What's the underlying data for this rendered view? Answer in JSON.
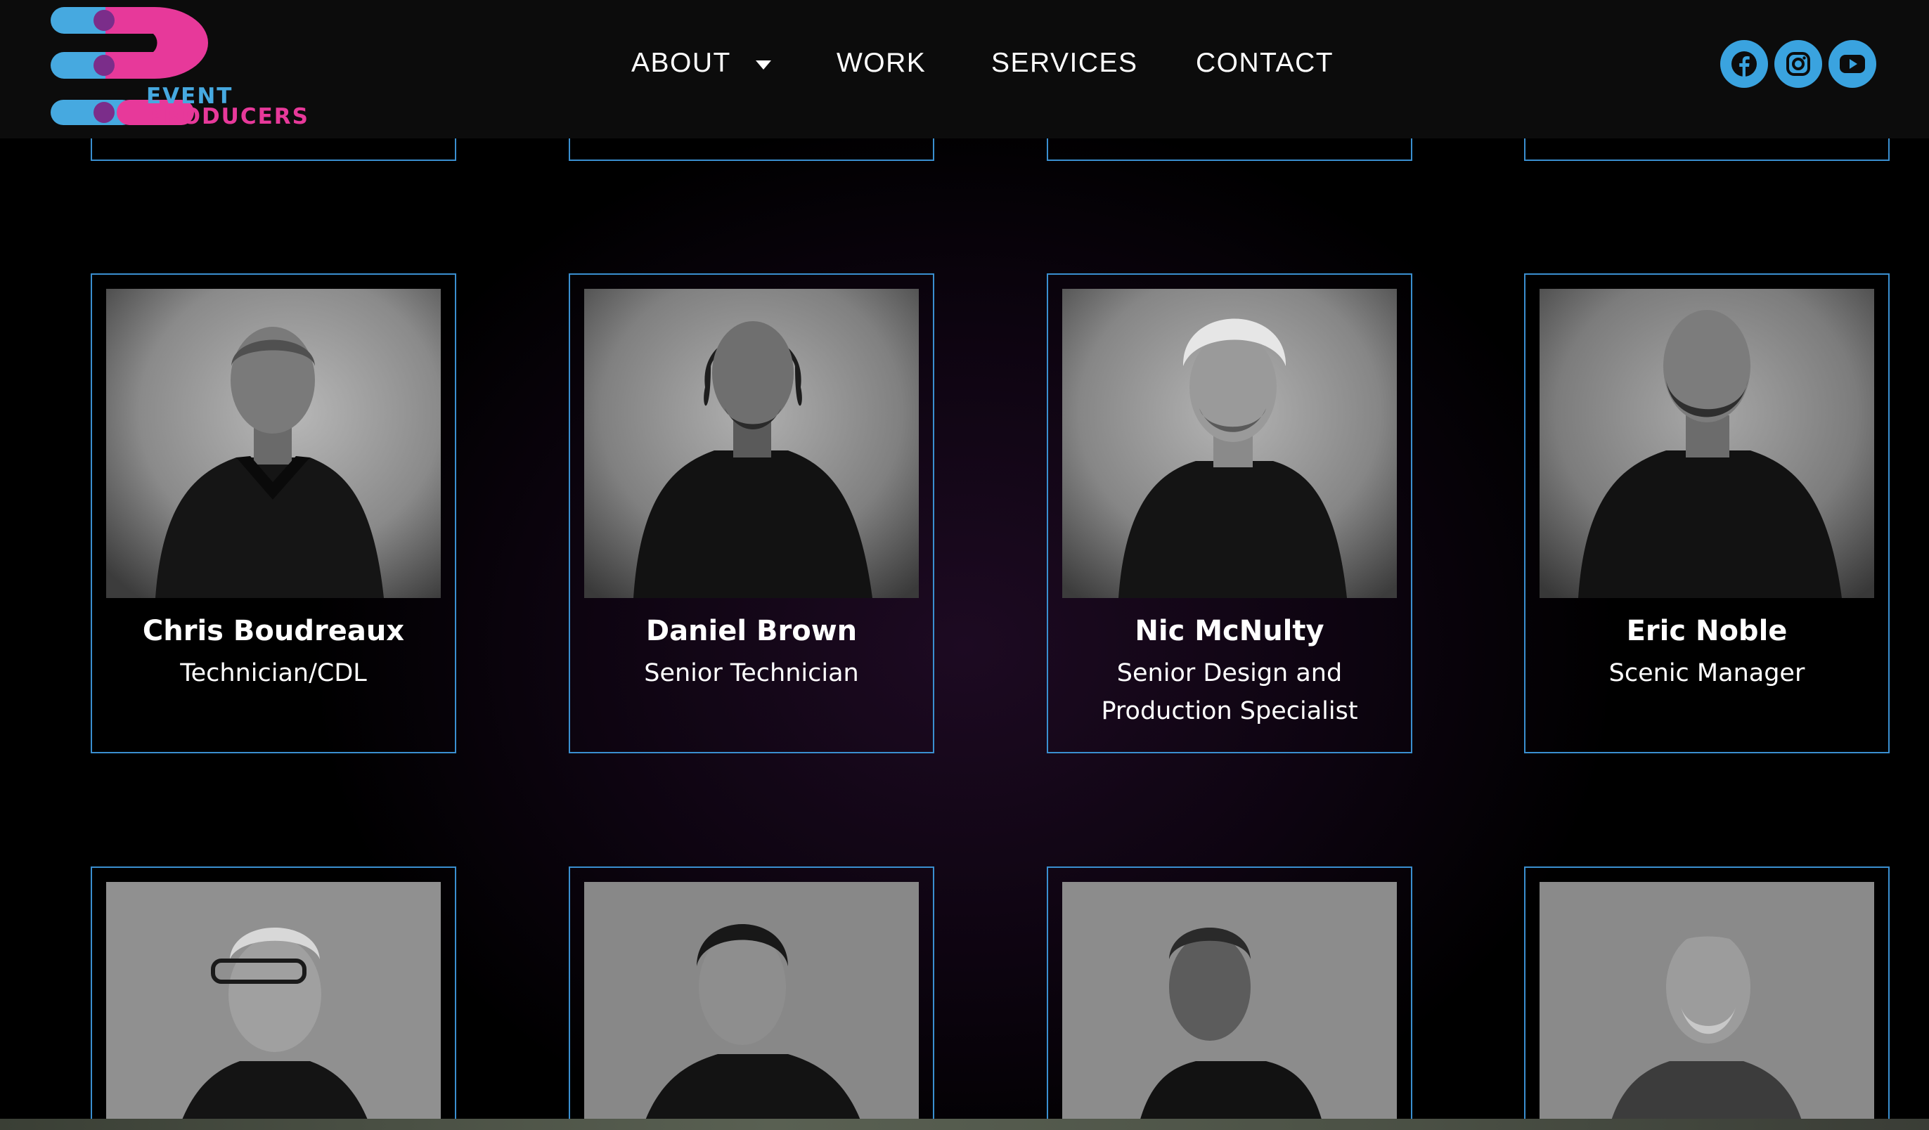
{
  "header": {
    "logo": {
      "word1": "EVENT",
      "word2": "PRODUCERS",
      "colors": {
        "blue": "#46a9e0",
        "pink": "#e7399a",
        "purple": "#7b2d8a"
      }
    },
    "nav": [
      {
        "label": "ABOUT",
        "has_dropdown": true
      },
      {
        "label": "WORK"
      },
      {
        "label": "SERVICES"
      },
      {
        "label": "CONTACT"
      }
    ],
    "social": [
      {
        "icon": "facebook-icon"
      },
      {
        "icon": "instagram-icon"
      },
      {
        "icon": "youtube-icon"
      }
    ],
    "accent": "#3aa3df"
  },
  "team": {
    "row2": [
      {
        "name": "Chris Boudreaux",
        "title": "Technician/CDL"
      },
      {
        "name": "Daniel Brown",
        "title": "Senior Technician"
      },
      {
        "name": "Nic McNulty",
        "title_line1": "Senior Design and",
        "title_line2": "Production Specialist"
      },
      {
        "name": "Eric Noble",
        "title": "Scenic Manager"
      }
    ]
  }
}
